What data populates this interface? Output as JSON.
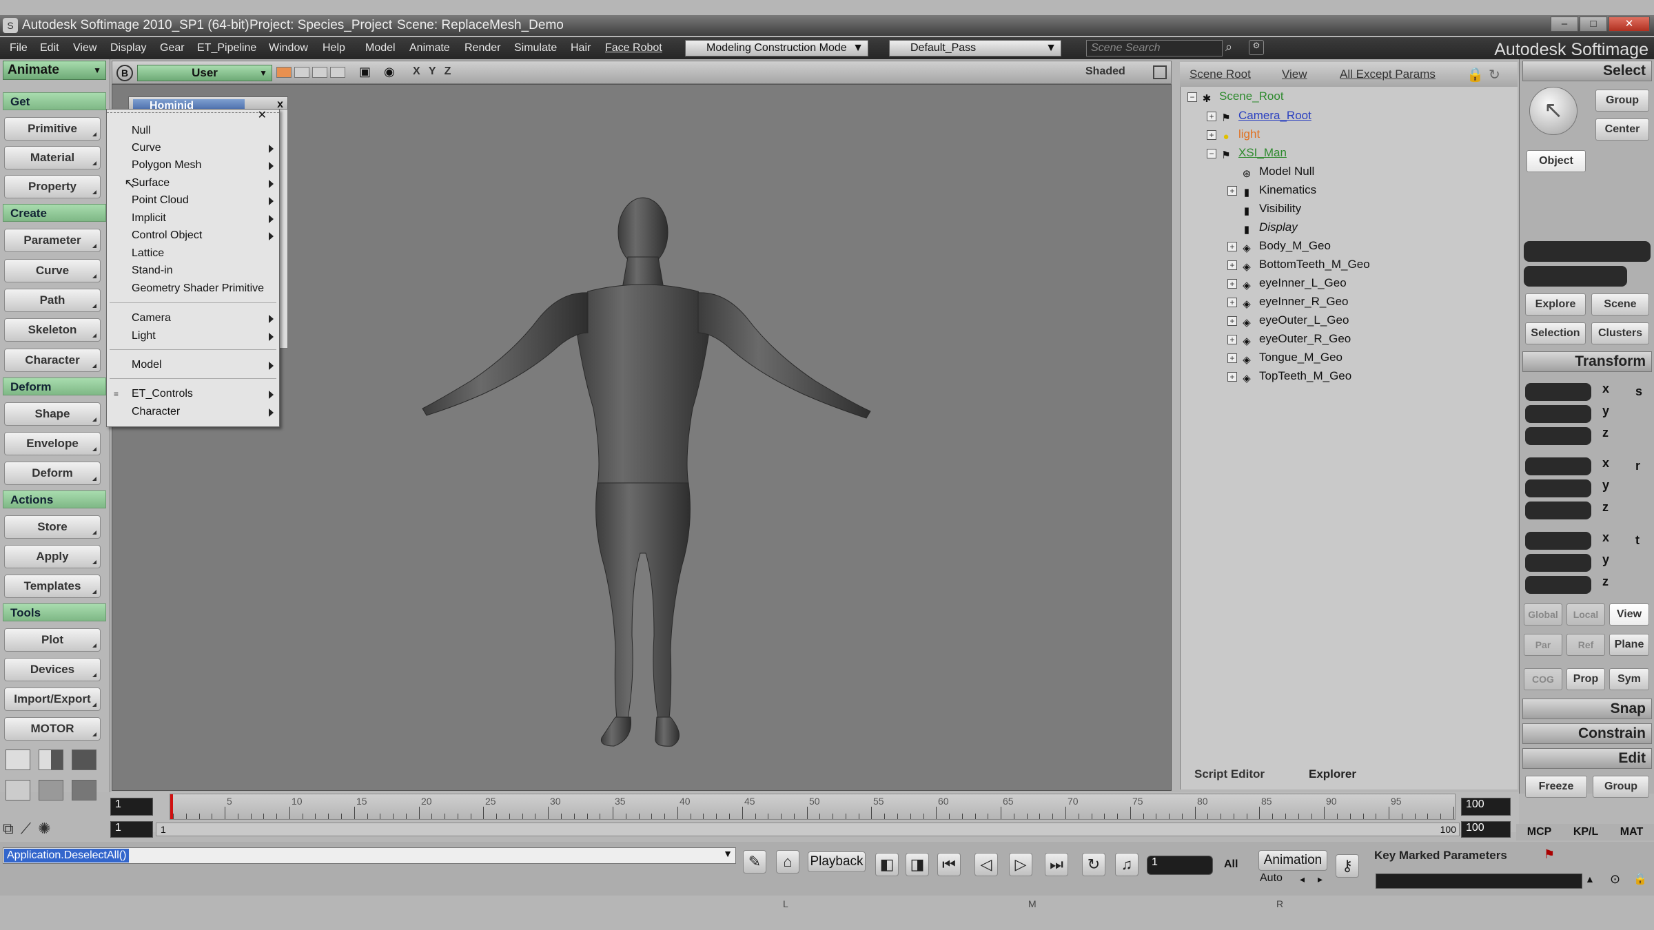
{
  "title": {
    "app": "Autodesk Softimage 2010_SP1 (64-bit)",
    "project": "Project: Species_Project",
    "scene": "Scene: ReplaceMesh_Demo"
  },
  "menubar": {
    "items": [
      "File",
      "Edit",
      "View",
      "Display",
      "Gear",
      "ET_Pipeline",
      "Window",
      "Help",
      "Model",
      "Animate",
      "Render",
      "Simulate",
      "Hair",
      "Face Robot"
    ],
    "mode": "Modeling Construction Mode",
    "pass": "Default_Pass",
    "search_placeholder": "Scene Search",
    "brand": "Autodesk Softimage"
  },
  "left_panel": {
    "module": "Animate",
    "sections": [
      {
        "title": "Get",
        "buttons": [
          "Primitive",
          "Material",
          "Property"
        ]
      },
      {
        "title": "Create",
        "buttons": [
          "Parameter",
          "Curve",
          "Path",
          "Skeleton",
          "Character"
        ]
      },
      {
        "title": "Deform",
        "buttons": [
          "Shape",
          "Envelope",
          "Deform"
        ]
      },
      {
        "title": "Actions",
        "buttons": [
          "Store",
          "Apply",
          "Templates"
        ]
      },
      {
        "title": "Tools",
        "buttons": [
          "Plot",
          "Devices",
          "Import/Export",
          "MOTOR"
        ]
      }
    ]
  },
  "viewport": {
    "camera": "User",
    "axes": "X Y Z",
    "shading": "Shaded",
    "badge": "B"
  },
  "popup": {
    "title": "Hominid",
    "close": "x",
    "items": [
      {
        "label": "Null",
        "arrow": false
      },
      {
        "label": "Curve",
        "arrow": true
      },
      {
        "label": "Polygon Mesh",
        "arrow": true
      },
      {
        "label": "Surface",
        "arrow": true
      },
      {
        "label": "Point Cloud",
        "arrow": true
      },
      {
        "label": "Implicit",
        "arrow": true
      },
      {
        "label": "Control Object",
        "arrow": true
      },
      {
        "label": "Lattice",
        "arrow": false
      },
      {
        "label": "Stand-in",
        "arrow": false
      },
      {
        "label": "Geometry Shader Primitive",
        "arrow": false
      },
      {
        "label": "Camera",
        "arrow": true
      },
      {
        "label": "Light",
        "arrow": true
      },
      {
        "label": "Model",
        "arrow": true
      },
      {
        "label": "ET_Controls",
        "arrow": true
      },
      {
        "label": "Character",
        "arrow": true
      }
    ]
  },
  "explorer": {
    "header": {
      "scope": "Scene Root",
      "view": "View",
      "filter": "All Except Params"
    },
    "tree": [
      {
        "label": "Scene_Root",
        "color": "#2e8a2e"
      },
      {
        "label": "Camera_Root",
        "color": "#2a40c0"
      },
      {
        "label": "light",
        "color": "#e07020"
      },
      {
        "label": "XSI_Man",
        "color": "#2e8a2e"
      },
      {
        "label": "Model Null",
        "color": "#111111"
      },
      {
        "label": "Kinematics",
        "color": "#111111"
      },
      {
        "label": "Visibility",
        "color": "#111111"
      },
      {
        "label": "Display",
        "color": "#111111"
      },
      {
        "label": "Body_M_Geo",
        "color": "#111111"
      },
      {
        "label": "BottomTeeth_M_Geo",
        "color": "#111111"
      },
      {
        "label": "eyeInner_L_Geo",
        "color": "#111111"
      },
      {
        "label": "eyeInner_R_Geo",
        "color": "#111111"
      },
      {
        "label": "eyeOuter_L_Geo",
        "color": "#111111"
      },
      {
        "label": "eyeOuter_R_Geo",
        "color": "#111111"
      },
      {
        "label": "Tongue_M_Geo",
        "color": "#111111"
      },
      {
        "label": "TopTeeth_M_Geo",
        "color": "#111111"
      }
    ],
    "tabs": [
      "Script Editor",
      "Explorer"
    ]
  },
  "right_panel": {
    "select_title": "Select",
    "group": "Group",
    "center": "Center",
    "object": "Object",
    "explore": "Explore",
    "scene": "Scene",
    "selection": "Selection",
    "clusters": "Clusters",
    "transform_title": "Transform",
    "axes": [
      "x",
      "y",
      "z"
    ],
    "trs": [
      "s",
      "r",
      "t"
    ],
    "global": "Global",
    "local": "Local",
    "view": "View",
    "par": "Par",
    "ref": "Ref",
    "plane": "Plane",
    "cog": "COG",
    "prop": "Prop",
    "sym": "Sym",
    "snap": "Snap",
    "constrain": "Constrain",
    "edit": "Edit",
    "freeze": "Freeze",
    "edit_group": "Group",
    "mcp": "MCP",
    "kpl": "KP/L",
    "mat": "MAT"
  },
  "timeline": {
    "start": "1",
    "end": "100",
    "current": "1",
    "range_start": "1",
    "range_end": "100",
    "range_end2": "100",
    "labels": [
      "5",
      "10",
      "15",
      "20",
      "25",
      "30",
      "35",
      "40",
      "45",
      "50",
      "55",
      "60",
      "65",
      "70",
      "75",
      "80",
      "85",
      "90",
      "95"
    ]
  },
  "status": {
    "command": "Application.DeselectAll()",
    "playback": "Playback",
    "frame": "1",
    "all": "All",
    "animation": "Animation",
    "auto": "Auto",
    "key_marked": "Key Marked Parameters",
    "mouse_l": "L",
    "mouse_m": "M",
    "mouse_r": "R"
  }
}
